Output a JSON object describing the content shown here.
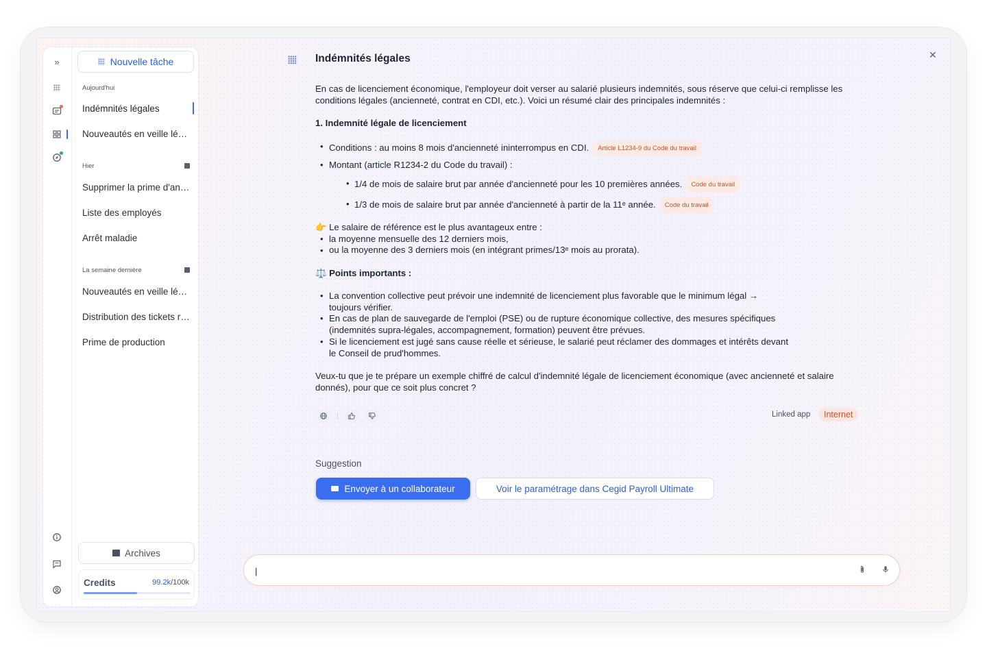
{
  "sidebar": {
    "new_task": "Nouvelle tâche",
    "sections": [
      {
        "label": "Aujourd'hui",
        "items": [
          "Indémnités légales",
          "Nouveautés en veille légale"
        ]
      },
      {
        "label": "Hier",
        "items": [
          "Supprimer la prime d'ancienneté",
          "Liste des employés",
          "Arrêt maladie"
        ]
      },
      {
        "label": "La semaine dernière",
        "items": [
          "Nouveautés en veille légale",
          "Distribution des tickets restaurant",
          "Prime de production"
        ]
      }
    ],
    "archives": "Archives",
    "credits_label": "Credits",
    "credits_used": "99.2k",
    "credits_total": "/100k",
    "credits_fraction": 0.5
  },
  "message": {
    "title": "Indémnités légales",
    "intro": "En cas de licenciement économique, l'employeur doit verser au salarié plusieurs indemnités, sous réserve que celui-ci remplisse les conditions légales (ancienneté, contrat en CDI, etc.). Voici un résumé clair des principales indemnités :",
    "section1_title": "1. Indemnité légale de licenciement",
    "cond": "Conditions : au moins 8 mois d'ancienneté ininterrompus en CDI.",
    "cond_tag": "Article L1234-9 du Code du travail",
    "montant": "Montant (article R1234-2 du Code du travail) :",
    "sub1": "1/4 de mois de salaire brut par année d'ancienneté pour les 10 premières années.",
    "sub1_tag": "Code du travail",
    "sub2": "1/3 de mois de salaire brut par année d'ancienneté à partir de la 11ᵉ année.",
    "sub2_tag": "Code du travail",
    "ref_title": "👉 Le salaire de référence est le plus avantageux entre :",
    "ref1": "la moyenne mensuelle des 12 derniers mois,",
    "ref2": "ou la moyenne des 3 derniers mois (en intégrant primes/13ᵉ mois au prorata).",
    "points_title": "⚖️ Points importants :",
    "p1a": "La convention collective peut prévoir une indemnité de licenciement plus favorable que le minimum légal →",
    "p1b": "toujours vérifier.",
    "p2a": "En cas de plan de sauvegarde de l'emploi (PSE) ou de rupture économique collective, des mesures spécifiques",
    "p2b": "(indemnités supra-légales, accompagnement, formation) peuvent être prévues.",
    "p3a": "Si le licenciement est jugé sans cause réelle et sérieuse, le salarié peut réclamer des dommages et intérêts devant",
    "p3b": "le Conseil de prud'hommes.",
    "closing": "Veux-tu que je te prépare un exemple chiffré de calcul d'indemnité légale de licenciement économique (avec ancienneté et salaire donnés), pour que ce soit plus concret ?",
    "linked_app": "Linked app",
    "internet": "Internet"
  },
  "suggestion": {
    "label": "Suggestion",
    "primary": "Envoyer à un collaborateur",
    "secondary": "Voir le paramétrage dans Cegid Payroll Ultimate"
  },
  "input": {
    "value": "|"
  }
}
